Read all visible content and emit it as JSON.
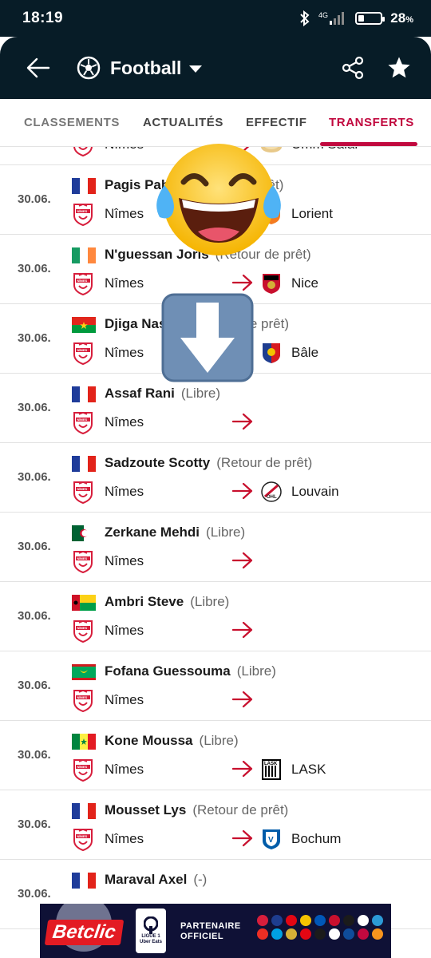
{
  "status_bar": {
    "time": "18:19",
    "network": "4G",
    "battery_pct": "28",
    "battery_unit": "%",
    "battery_level": 0.28
  },
  "app_bar": {
    "title": "Football"
  },
  "tabs": [
    {
      "label": "CLASSEMENTS"
    },
    {
      "label": "ACTUALITÉS"
    },
    {
      "label": "EFFECTIF"
    },
    {
      "label": "TRANSFERTS",
      "active": true
    }
  ],
  "transfers": [
    {
      "date": "",
      "player": "",
      "type": "",
      "from": "Nîmes",
      "to": "Umm Salal",
      "flag": "",
      "dest_logo": "umm-salal"
    },
    {
      "date": "30.06.",
      "player": "Pagis Pablo",
      "type": "(Retour de prêt)",
      "from": "Nîmes",
      "to": "Lorient",
      "flag": "france",
      "dest_logo": "lorient"
    },
    {
      "date": "30.06.",
      "player": "N'guessan Joris",
      "type": "(Retour de prêt)",
      "from": "Nîmes",
      "to": "Nice",
      "flag": "ireland",
      "dest_logo": "nice"
    },
    {
      "date": "30.06.",
      "player": "Djiga Nasser",
      "type": "(Retour de prêt)",
      "from": "Nîmes",
      "to": "Bâle",
      "flag": "burkina-faso",
      "dest_logo": "basel"
    },
    {
      "date": "30.06.",
      "player": "Assaf Rani",
      "type": "(Libre)",
      "from": "Nîmes",
      "to": "",
      "flag": "france",
      "dest_logo": ""
    },
    {
      "date": "30.06.",
      "player": "Sadzoute Scotty",
      "type": "(Retour de prêt)",
      "from": "Nîmes",
      "to": "Louvain",
      "flag": "france",
      "dest_logo": "ohl"
    },
    {
      "date": "30.06.",
      "player": "Zerkane Mehdi",
      "type": "(Libre)",
      "from": "Nîmes",
      "to": "",
      "flag": "algeria",
      "dest_logo": ""
    },
    {
      "date": "30.06.",
      "player": "Ambri Steve",
      "type": "(Libre)",
      "from": "Nîmes",
      "to": "",
      "flag": "guinea-bissau",
      "dest_logo": ""
    },
    {
      "date": "30.06.",
      "player": "Fofana Guessouma",
      "type": "(Libre)",
      "from": "Nîmes",
      "to": "",
      "flag": "mauritania",
      "dest_logo": ""
    },
    {
      "date": "30.06.",
      "player": "Kone Moussa",
      "type": "(Libre)",
      "from": "Nîmes",
      "to": "LASK",
      "flag": "senegal",
      "dest_logo": "lask"
    },
    {
      "date": "30.06.",
      "player": "Mousset Lys",
      "type": "(Retour de prêt)",
      "from": "Nîmes",
      "to": "Bochum",
      "flag": "france",
      "dest_logo": "bochum"
    },
    {
      "date": "30.06.",
      "player": "Maraval Axel",
      "type": "(-)",
      "from": "",
      "to": "",
      "flag": "france",
      "dest_logo": ""
    }
  ],
  "banner": {
    "brand": "Betclic",
    "league": "LIGUE 1\nUber Eats",
    "partner_line1": "PARTENAIRE",
    "partner_line2": "OFFICIEL"
  },
  "colors": {
    "header_bg": "#071c27",
    "accent": "#c1093f",
    "nimes_red": "#d71e3c"
  },
  "icons": [
    "back-arrow-icon",
    "football-icon",
    "dropdown-caret-icon",
    "share-icon",
    "star-icon",
    "transfer-arrow-icon",
    "laughing-emoji",
    "down-arrow-emoji"
  ]
}
